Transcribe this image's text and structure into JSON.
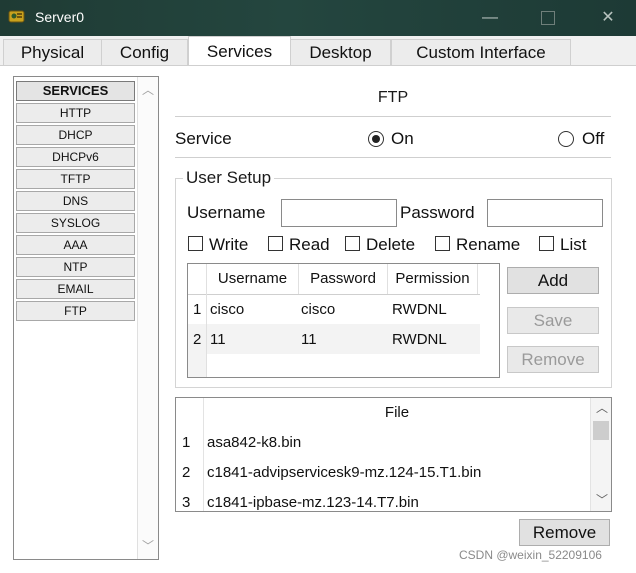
{
  "window": {
    "title": "Server0",
    "icon": "packet-tracer-server-icon"
  },
  "tabs": [
    {
      "label": "Physical",
      "active": false
    },
    {
      "label": "Config",
      "active": false
    },
    {
      "label": "Services",
      "active": true
    },
    {
      "label": "Desktop",
      "active": false
    },
    {
      "label": "Custom Interface",
      "active": false
    }
  ],
  "sidebar": {
    "header": "SERVICES",
    "items": [
      "HTTP",
      "DHCP",
      "DHCPv6",
      "TFTP",
      "DNS",
      "SYSLOG",
      "AAA",
      "NTP",
      "EMAIL",
      "FTP"
    ]
  },
  "ftp": {
    "title": "FTP",
    "service_label": "Service",
    "on_label": "On",
    "off_label": "Off",
    "service_state": "On"
  },
  "user_setup": {
    "legend": "User Setup",
    "username_label": "Username",
    "password_label": "Password",
    "username_value": "",
    "password_value": "",
    "permissions": [
      "Write",
      "Read",
      "Delete",
      "Rename",
      "List"
    ],
    "columns": [
      "Username",
      "Password",
      "Permission"
    ],
    "rows": [
      {
        "index": "1",
        "username": "cisco",
        "password": "cisco",
        "permission": "RWDNL"
      },
      {
        "index": "2",
        "username": "11",
        "password": "11",
        "permission": "RWDNL"
      }
    ],
    "add_button": "Add",
    "save_button": "Save",
    "remove_button": "Remove"
  },
  "files": {
    "header": "File",
    "rows": [
      {
        "index": "1",
        "name": "asa842-k8.bin"
      },
      {
        "index": "2",
        "name": "c1841-advipservicesk9-mz.124-15.T1.bin"
      },
      {
        "index": "3",
        "name": "c1841-ipbase-mz.123-14.T7.bin"
      }
    ],
    "remove_button": "Remove"
  },
  "watermark": "CSDN @weixin_52209106"
}
